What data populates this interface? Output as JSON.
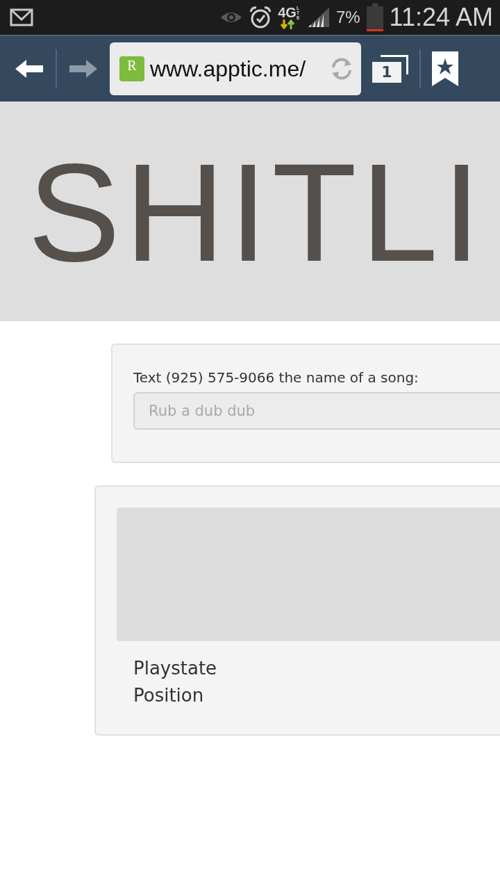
{
  "status_bar": {
    "network": "4G",
    "network_sub": "LTE",
    "battery": "7%",
    "time": "11:24 AM"
  },
  "browser": {
    "forward_disabled": true,
    "favicon_letter": "R",
    "url": "www.apptic.me/",
    "tab_count": "1"
  },
  "logo": {
    "text": "SHITLI"
  },
  "song_form": {
    "label": "Text (925) 575-9066 the name of a song:",
    "placeholder": "Rub a dub dub"
  },
  "player": {
    "fields": [
      {
        "label": "Playstate"
      },
      {
        "label": "Position"
      }
    ]
  }
}
